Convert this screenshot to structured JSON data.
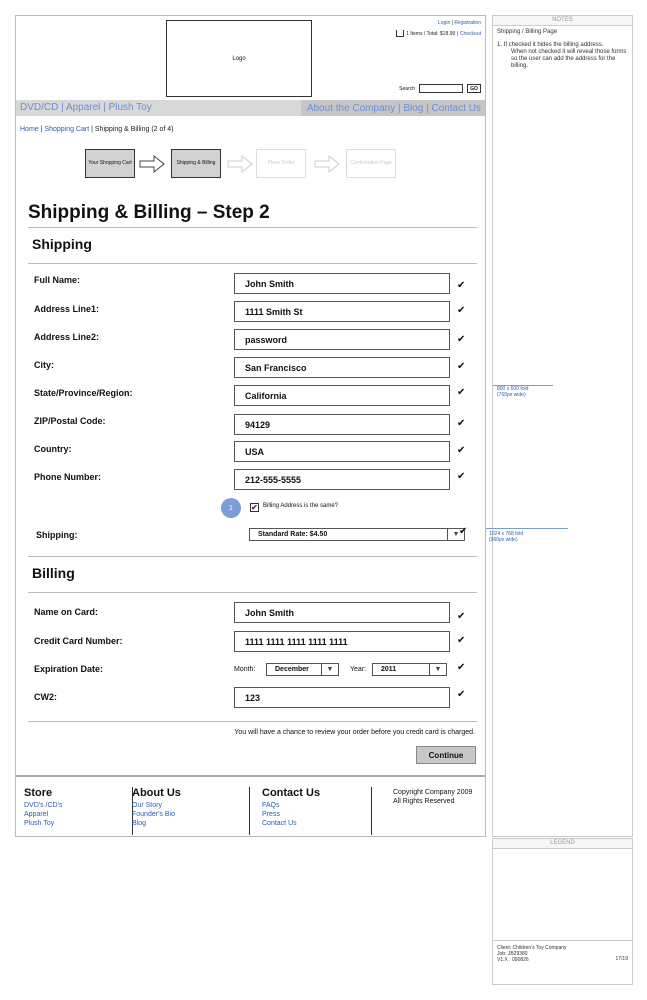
{
  "header": {
    "logo": "Logo",
    "login": "Login",
    "registration": "Registration",
    "cart_items": "1 Items / Total: $18.99 |",
    "checkout": "Checkout",
    "search_label": "Search",
    "go": "GO"
  },
  "nav": {
    "left": "DVD/CD | Apparel | Plush Toy",
    "right": "About the Company | Blog | Contact Us"
  },
  "breadcrumb": {
    "home": "Home",
    "cart": "Shopping Cart",
    "current": "Shipping & Billing (2 of 4)"
  },
  "steps": [
    "Your Shopping Cart",
    "Shipping & Billing",
    "Place Order",
    "Confirmation Page"
  ],
  "page_title": "Shipping & Billing – Step 2",
  "shipping": {
    "title": "Shipping",
    "fields": [
      {
        "label": "Full Name:",
        "value": "John Smith"
      },
      {
        "label": "Address Line1:",
        "value": "1111 Smith St"
      },
      {
        "label": "Address Line2:",
        "value": "password"
      },
      {
        "label": "City:",
        "value": "San Francisco"
      },
      {
        "label": "State/Province/Region:",
        "value": "California"
      },
      {
        "label": "ZIP/Postal Code:",
        "value": "94129"
      },
      {
        "label": "Country:",
        "value": "USA"
      },
      {
        "label": "Phone Number:",
        "value": "212-555-5555"
      }
    ],
    "badge": "1",
    "same_billing_label": "Billing Address is the same?",
    "shipping_label": "Shipping:",
    "shipping_rate": "Standard Rate: $4.50"
  },
  "billing": {
    "title": "Billing",
    "name_label": "Name on Card:",
    "name_value": "John Smith",
    "card_label": "Credit Card Number:",
    "card_value": "1111 1111 1111 1111 1111",
    "exp_label": "Expiration Date:",
    "month_label": "Month:",
    "month_value": "December",
    "year_label": "Year:",
    "year_value": "2011",
    "cvv_label": "CW2:",
    "cvv_value": "123"
  },
  "review_note": "You will have a chance to review your order before you credit card is charged.",
  "continue": "Continue",
  "check_glyph": "✔",
  "arrow_glyph": "▼",
  "footer": {
    "store": {
      "title": "Store",
      "links": [
        "DVD's /CD's",
        "Apparel",
        "Plush Toy"
      ]
    },
    "about": {
      "title": "About Us",
      "links": [
        "Our Story",
        "Founder's Bio",
        "Blog"
      ]
    },
    "contact": {
      "title": "Contact Us",
      "links": [
        "FAQs",
        "Press",
        "Contact Us"
      ]
    },
    "copyright": [
      "Copyright Company 2009",
      "All Rights Reserved"
    ]
  },
  "notes": {
    "header": "NOTES",
    "title": "Shipping / Billing Page",
    "item1": "1. If checked it hides the billing address.",
    "item1_cont": "When not checked it will reveal those forms so the user can add the address for the billing.",
    "fold1": [
      "800 x 600 fold",
      "(760px wide)"
    ],
    "fold2": [
      "1024 x 768 fold",
      "(960px wide)"
    ]
  },
  "legend": {
    "header": "LEGEND"
  },
  "client": {
    "lines": [
      "Client: Children's Toy Company",
      "Job: JB29380",
      "V1.X : 090826"
    ],
    "page": "17/19"
  }
}
